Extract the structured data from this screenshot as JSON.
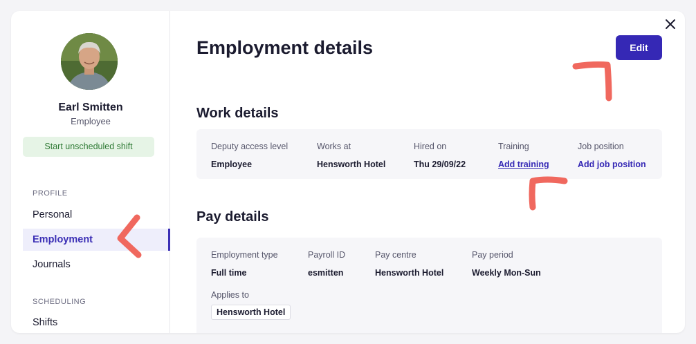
{
  "profile": {
    "name": "Earl Smitten",
    "role": "Employee",
    "start_shift_label": "Start unscheduled shift"
  },
  "sidebar": {
    "sections": [
      {
        "label": "PROFILE",
        "items": [
          {
            "label": "Personal"
          },
          {
            "label": "Employment",
            "active": true
          },
          {
            "label": "Journals"
          }
        ]
      },
      {
        "label": "SCHEDULING",
        "items": [
          {
            "label": "Shifts"
          }
        ]
      }
    ]
  },
  "main": {
    "title": "Employment details",
    "edit_label": "Edit",
    "work_details": {
      "title": "Work details",
      "fields": [
        {
          "label": "Deputy access level",
          "value": "Employee"
        },
        {
          "label": "Works at",
          "value": "Hensworth Hotel"
        },
        {
          "label": "Hired on",
          "value": "Thu 29/09/22"
        },
        {
          "label": "Training",
          "value": "Add training"
        },
        {
          "label": "Job position",
          "value": "Add job position"
        }
      ]
    },
    "pay_details": {
      "title": "Pay details",
      "fields": [
        {
          "label": "Employment type",
          "value": "Full time"
        },
        {
          "label": "Payroll ID",
          "value": "esmitten"
        },
        {
          "label": "Pay centre",
          "value": "Hensworth Hotel"
        },
        {
          "label": "Pay period",
          "value": "Weekly Mon-Sun"
        }
      ],
      "applies_to": {
        "label": "Applies to",
        "value": "Hensworth Hotel"
      }
    }
  },
  "colors": {
    "accent": "#3528b5",
    "annotation": "#f0685e",
    "success_bg": "#e6f4e6",
    "success_text": "#2f7a35"
  }
}
